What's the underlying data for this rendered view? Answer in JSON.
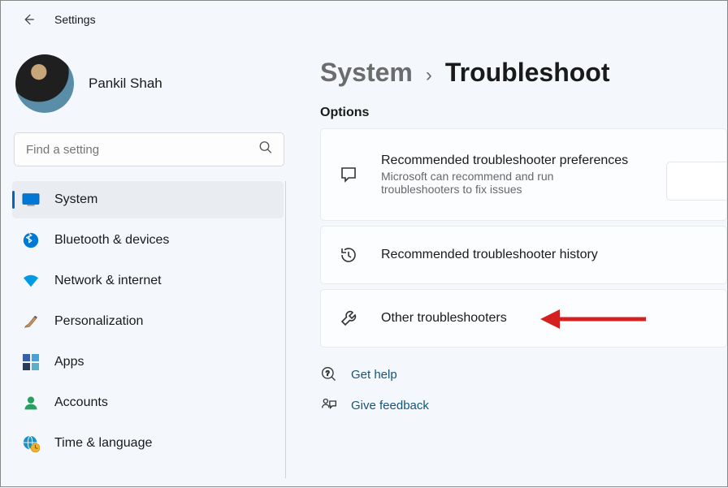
{
  "app_title": "Settings",
  "profile": {
    "name": "Pankil Shah"
  },
  "search": {
    "placeholder": "Find a setting"
  },
  "sidebar": {
    "items": [
      {
        "label": "System",
        "icon": "monitor-icon",
        "active": true
      },
      {
        "label": "Bluetooth & devices",
        "icon": "bluetooth-icon"
      },
      {
        "label": "Network & internet",
        "icon": "wifi-icon"
      },
      {
        "label": "Personalization",
        "icon": "paintbrush-icon"
      },
      {
        "label": "Apps",
        "icon": "apps-icon"
      },
      {
        "label": "Accounts",
        "icon": "person-icon"
      },
      {
        "label": "Time & language",
        "icon": "globe-clock-icon"
      }
    ]
  },
  "breadcrumb": {
    "parent": "System",
    "current": "Troubleshoot"
  },
  "section_label": "Options",
  "cards": [
    {
      "title": "Recommended troubleshooter preferences",
      "subtitle": "Microsoft can recommend and run troubleshooters to fix issues",
      "icon": "chat-icon"
    },
    {
      "title": "Recommended troubleshooter history",
      "icon": "history-icon"
    },
    {
      "title": "Other troubleshooters",
      "icon": "wrench-icon"
    }
  ],
  "help_links": [
    {
      "label": "Get help",
      "icon": "help-icon"
    },
    {
      "label": "Give feedback",
      "icon": "feedback-icon"
    }
  ]
}
